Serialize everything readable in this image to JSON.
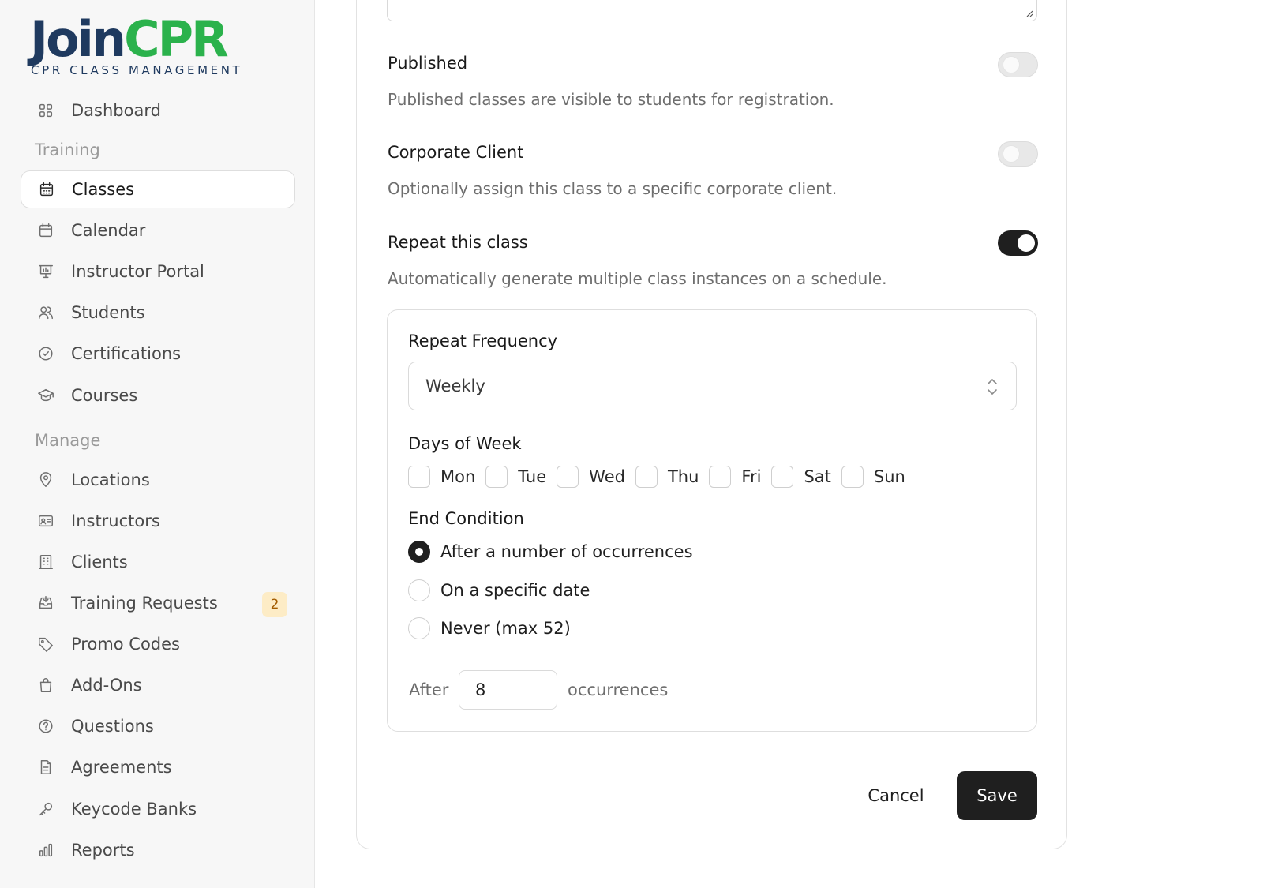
{
  "brand": {
    "word_primary": "Join",
    "word_accent": "CPR",
    "tagline": "CPR CLASS MANAGEMENT",
    "colors": {
      "navy": "#1f3a5f",
      "green": "#2bb24c"
    }
  },
  "sidebar": {
    "dashboard": {
      "label": "Dashboard",
      "icon": "grid-icon"
    },
    "section_training": "Training",
    "training_items": [
      {
        "label": "Classes",
        "icon": "calendar-grid-icon",
        "active": true
      },
      {
        "label": "Calendar",
        "icon": "calendar-icon"
      },
      {
        "label": "Instructor Portal",
        "icon": "presentation-board-icon"
      },
      {
        "label": "Students",
        "icon": "users-icon"
      },
      {
        "label": "Certifications",
        "icon": "badge-check-icon"
      },
      {
        "label": "Courses",
        "icon": "graduation-cap-icon"
      }
    ],
    "section_manage": "Manage",
    "manage_items": [
      {
        "label": "Locations",
        "icon": "map-pin-icon"
      },
      {
        "label": "Instructors",
        "icon": "id-card-icon"
      },
      {
        "label": "Clients",
        "icon": "building-icon"
      },
      {
        "label": "Training Requests",
        "icon": "inbox-icon",
        "badge": "2"
      },
      {
        "label": "Promo Codes",
        "icon": "tag-icon"
      },
      {
        "label": "Add-Ons",
        "icon": "shopping-bag-icon"
      },
      {
        "label": "Questions",
        "icon": "help-circle-icon"
      },
      {
        "label": "Agreements",
        "icon": "file-text-icon"
      },
      {
        "label": "Keycode Banks",
        "icon": "key-icon"
      },
      {
        "label": "Reports",
        "icon": "bar-chart-icon"
      }
    ]
  },
  "form": {
    "published": {
      "title": "Published",
      "description": "Published classes are visible to students for registration.",
      "enabled": false
    },
    "corporate": {
      "title": "Corporate Client",
      "description": "Optionally assign this class to a specific corporate client.",
      "enabled": false
    },
    "repeat": {
      "title": "Repeat this class",
      "description": "Automatically generate multiple class instances on a schedule.",
      "enabled": true
    },
    "frequency": {
      "label": "Repeat Frequency",
      "value": "Weekly"
    },
    "days": {
      "label": "Days of Week",
      "options": [
        "Mon",
        "Tue",
        "Wed",
        "Thu",
        "Fri",
        "Sat",
        "Sun"
      ]
    },
    "end_condition": {
      "label": "End Condition",
      "options": [
        "After a number of occurrences",
        "On a specific date",
        "Never (max 52)"
      ],
      "selected": "After a number of occurrences"
    },
    "occurrences": {
      "prefix": "After",
      "value": "8",
      "suffix": "occurrences"
    },
    "actions": {
      "cancel": "Cancel",
      "save": "Save"
    }
  }
}
